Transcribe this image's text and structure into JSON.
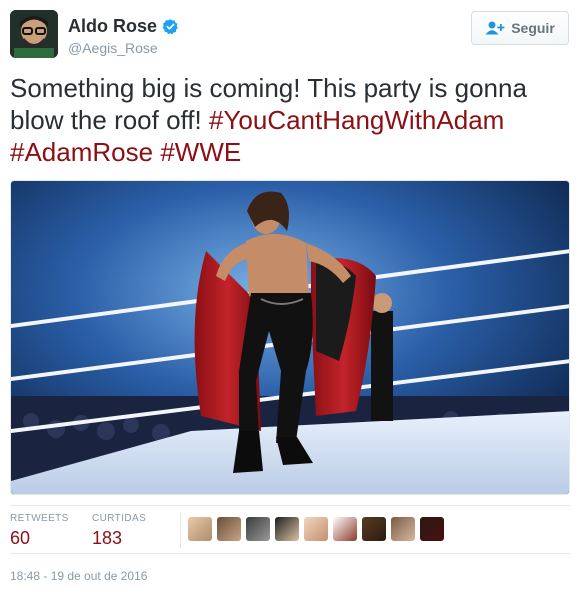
{
  "user": {
    "display_name": "Aldo Rose",
    "handle": "@Aegis_Rose",
    "verified_icon": "verified-badge-icon"
  },
  "follow_button": {
    "label": "Seguir",
    "icon": "add-user-icon"
  },
  "tweet": {
    "text_plain": "Something big is coming! This party is gonna blow the roof off!",
    "hashtags": [
      "#YouCantHangWithAdam",
      "#AdamRose",
      "#WWE"
    ]
  },
  "stats": {
    "retweets_label": "RETWEETS",
    "retweets_value": "60",
    "likes_label": "CURTIDAS",
    "likes_value": "183"
  },
  "liked_by_count": 9,
  "timestamp": "18:48 - 19 de out de 2016",
  "colors": {
    "hashtag": "#8b0f14",
    "stat_value": "#8b0f14",
    "muted": "#8899a6",
    "verified": "#1da1f2"
  }
}
